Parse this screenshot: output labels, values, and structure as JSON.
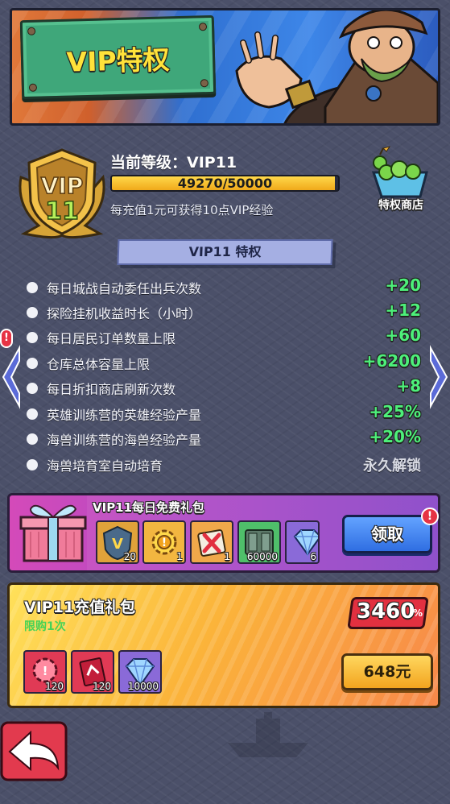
{
  "banner": {
    "title": "VIP特权"
  },
  "vip": {
    "badge_text": "VIP",
    "badge_level": "11",
    "level_label": "当前等级：VIP11",
    "xp_text": "49270/50000",
    "xp_progress": 0.9854,
    "xp_hint": "每充值1元可获得10点VIP经验"
  },
  "shop": {
    "label": "特权商店"
  },
  "privileges": {
    "header": "VIP11 特权",
    "items": [
      {
        "label": "每日城战自动委任出兵次数",
        "value": "+20"
      },
      {
        "label": "探险挂机收益时长（小时）",
        "value": "+12"
      },
      {
        "label": "每日居民订单数量上限",
        "value": "+60"
      },
      {
        "label": "仓库总体容量上限",
        "value": "+6200"
      },
      {
        "label": "每日折扣商店刷新次数",
        "value": "+8"
      },
      {
        "label": "英雄训练营的英雄经验产量",
        "value": "+25%"
      },
      {
        "label": "海兽训练营的海兽经验产量",
        "value": "+20%"
      },
      {
        "label": "海兽培育室自动培育",
        "value": "永久解锁"
      }
    ]
  },
  "daily_gift": {
    "title": "VIP11每日免费礼包",
    "items": [
      {
        "icon": "vip-coin-icon",
        "count": "20"
      },
      {
        "icon": "gold-gear-icon",
        "count": "1"
      },
      {
        "icon": "crossed-scroll-icon",
        "count": "1"
      },
      {
        "icon": "cash-stack-icon",
        "count": "60000"
      },
      {
        "icon": "diamond-icon",
        "count": "6"
      }
    ],
    "claim_label": "领取",
    "alert": "!"
  },
  "recharge_pack": {
    "title": "VIP11充值礼包",
    "limit": "限购1次",
    "discount": "3460",
    "discount_unit": "%",
    "items": [
      {
        "icon": "red-gear-icon",
        "count": "120"
      },
      {
        "icon": "red-book-icon",
        "count": "120"
      },
      {
        "icon": "diamond-icon",
        "count": "10000"
      }
    ],
    "price": "648元"
  },
  "side_alert": "!",
  "colors": {
    "background": "#4b5069",
    "bonus_green": "#4df07a",
    "claim_blue": "#2f6ee2",
    "price_gold": "#f2a41f",
    "discount_red": "#e23040"
  }
}
